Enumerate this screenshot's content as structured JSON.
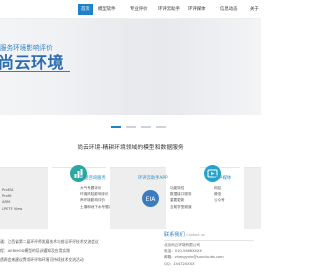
{
  "nav": {
    "items": [
      {
        "label": "首页",
        "active": true
      },
      {
        "label": "模型软件",
        "active": false
      },
      {
        "label": "专业评价",
        "active": false
      },
      {
        "label": "环评云助手",
        "active": false
      },
      {
        "label": "环评媒体",
        "active": false
      },
      {
        "label": "信息动态",
        "active": false
      },
      {
        "label": "关于",
        "active": false
      }
    ]
  },
  "hero": {
    "slogan": "服务环境影响评价",
    "brand": "尚云环境"
  },
  "slider": {
    "count": 4,
    "active_index": 0
  },
  "section": {
    "title": "尚云环境-精耕环境领域的模型和数据服务"
  },
  "cards": [
    {
      "title": "",
      "items": [
        "ProEIA",
        "Profit",
        "ARM",
        "LPETF View"
      ]
    },
    {
      "title": "专题咨询服务",
      "items": [
        "大气专题评价",
        "环境风险影响评价",
        "声环境影响评价",
        "土壤和地下水专题评价"
      ]
    },
    {
      "title": "环评云助手APP",
      "icon_label": "EIA",
      "items": [
        "功能特性",
        "数据接口服务",
        "重要更新",
        "互助学堂频道"
      ]
    },
    {
      "title": "环评媒体",
      "items": [
        "网站",
        "微信",
        "公众号"
      ]
    },
    {
      "title": "",
      "items": []
    }
  ],
  "news": {
    "items": [
      "通：江西省第二届环评师发展技术与前沿环评技术交流会议",
      "程：AERMOD模型的培训通知及应用实践",
      "",
      "透两会来建议贯彻环评和环境可持续技术交流活动"
    ]
  },
  "contact": {
    "title": "联系我们",
    "title_sub": "Contact us",
    "items": [
      "北京尚云环境有限公司",
      "电话：010-5966XXXX",
      "邮箱：zhangyxin@sunclouds.com",
      "QQ：14472XXXX"
    ]
  },
  "colors": {
    "accent": "#1f82c8",
    "brand_text": "#2a6cb0",
    "card_grey": "#eeeeee"
  },
  "icons": [
    "chart-icon",
    "consult-icon",
    "eia-app-icon",
    "media-icon"
  ]
}
